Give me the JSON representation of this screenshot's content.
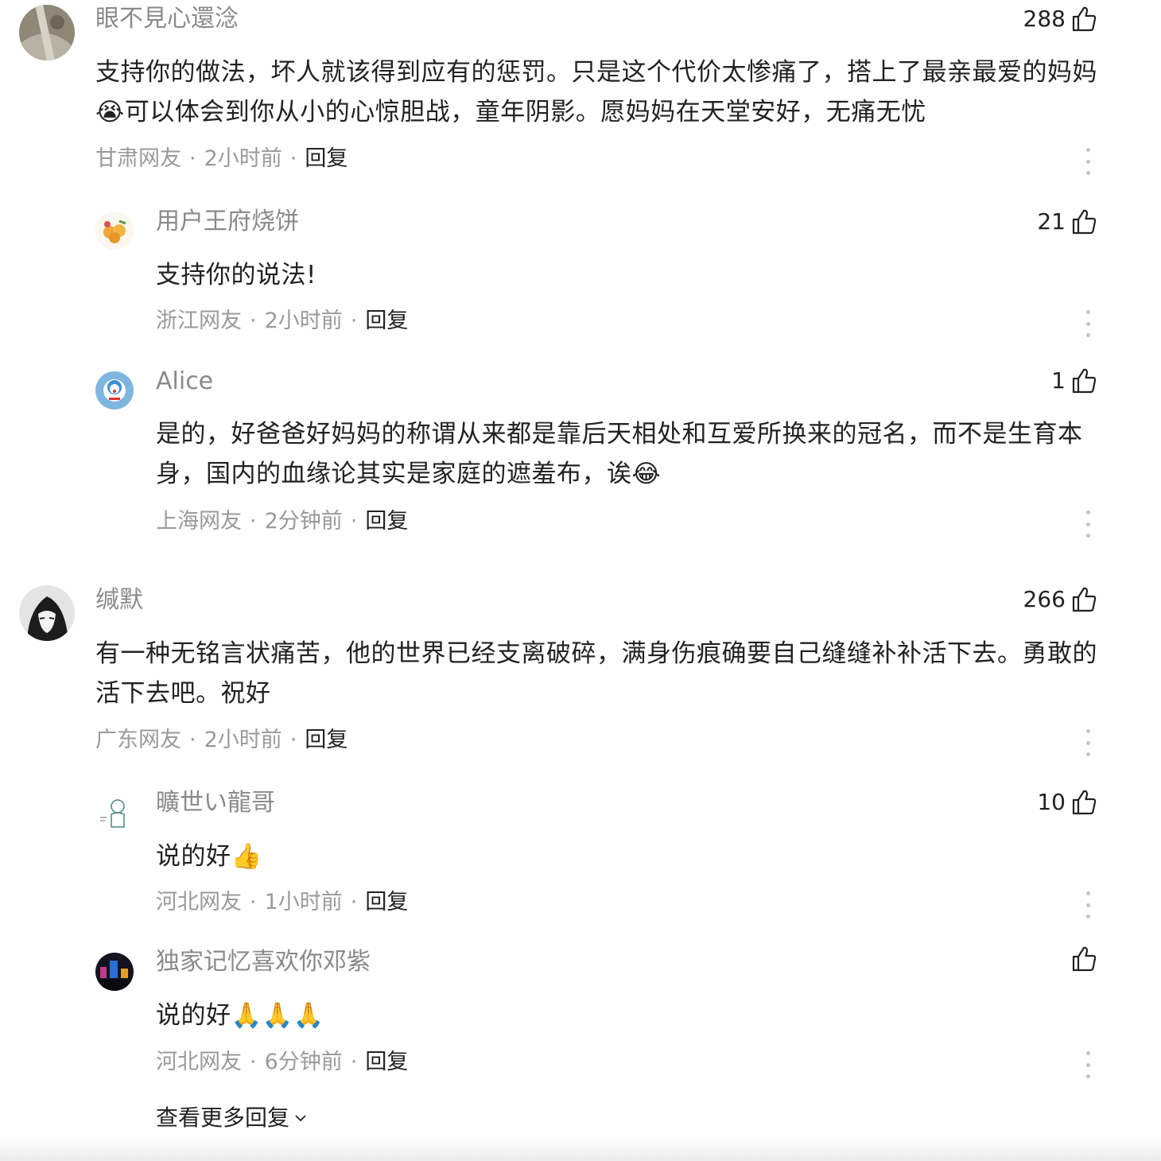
{
  "comments": [
    {
      "username": "眼不見心還淰",
      "likes": "288",
      "text": "支持你的做法，坏人就该得到应有的惩罚。只是这个代价太惨痛了，搭上了最亲最爱的妈妈😭可以体会到你从小的心惊胆战，童年阴影。愿妈妈在天堂安好，无痛无忧",
      "location": "甘肃网友",
      "time": "2小时前",
      "reply_label": "回复"
    },
    {
      "username": "用户王府烧饼",
      "likes": "21",
      "text": "支持你的说法!",
      "location": "浙江网友",
      "time": "2小时前",
      "reply_label": "回复"
    },
    {
      "username": "Alice",
      "likes": "1",
      "text": "是的，好爸爸好妈妈的称谓从来都是靠后天相处和互爱所换来的冠名，而不是生育本身，国内的血缘论其实是家庭的遮羞布，诶😂",
      "location": "上海网友",
      "time": "2分钟前",
      "reply_label": "回复"
    },
    {
      "username": "缄默",
      "likes": "266",
      "text": "有一种无铭言状痛苦，他的世界已经支离破碎，满身伤痕确要自己缝缝补补活下去。勇敢的活下去吧。祝好",
      "location": "广东网友",
      "time": "2小时前",
      "reply_label": "回复"
    },
    {
      "username": "曠世い龍哥",
      "likes": "10",
      "text": "说的好👍",
      "location": "河北网友",
      "time": "1小时前",
      "reply_label": "回复"
    },
    {
      "username": "独家记忆喜欢你邓紫",
      "likes": "",
      "text": "说的好🙏🙏🙏",
      "location": "河北网友",
      "time": "6分钟前",
      "reply_label": "回复"
    }
  ],
  "view_more_label": "查看更多回复",
  "meta_separator": "·",
  "colors": {
    "username": "#8a8a8a",
    "meta": "#9a9a9a",
    "text": "#222222",
    "more_dots": "#c4c4c4"
  },
  "icons": {
    "like": "thumbs-up-outline-icon",
    "more": "vertical-dots-icon",
    "expand": "chevron-down-icon"
  }
}
